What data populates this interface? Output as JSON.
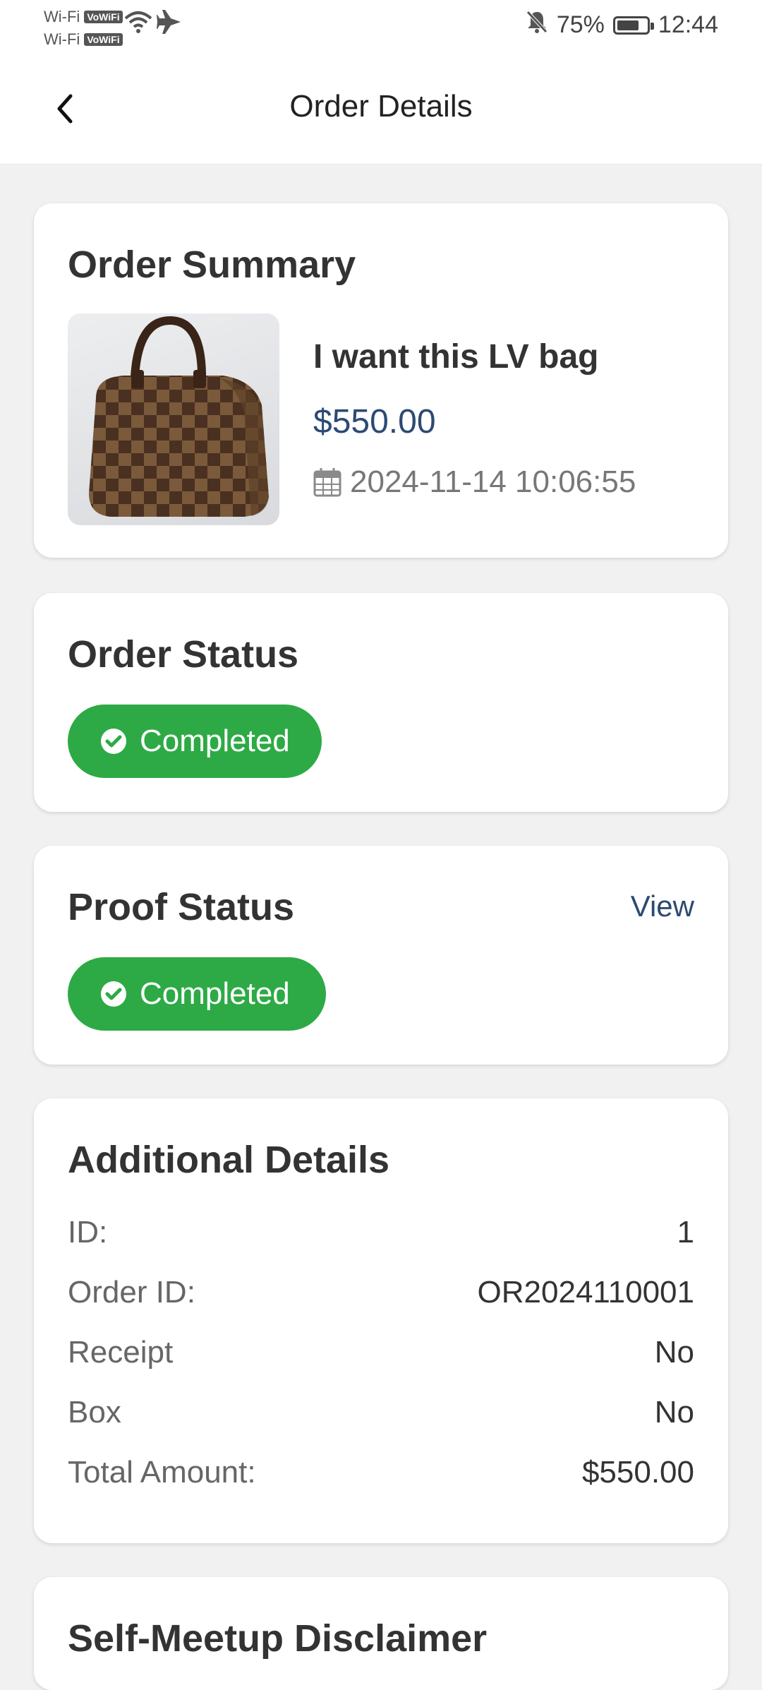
{
  "status_bar": {
    "net1": "Wi-Fi",
    "net2": "Wi-Fi",
    "vowifi": "VoWiFi",
    "battery": "75%",
    "time": "12:44"
  },
  "header": {
    "title": "Order Details"
  },
  "summary": {
    "title": "Order Summary",
    "product_name": "I want this LV bag",
    "price": "$550.00",
    "date": "2024-11-14 10:06:55"
  },
  "order_status": {
    "title": "Order Status",
    "badge": "Completed"
  },
  "proof_status": {
    "title": "Proof Status",
    "view": "View",
    "badge": "Completed"
  },
  "details": {
    "title": "Additional Details",
    "rows": [
      {
        "label": "ID:",
        "value": "1"
      },
      {
        "label": "Order ID:",
        "value": "OR2024110001"
      },
      {
        "label": "Receipt",
        "value": "No"
      },
      {
        "label": "Box",
        "value": "No"
      },
      {
        "label": "Total Amount:",
        "value": "$550.00"
      }
    ]
  },
  "disclaimer": {
    "title": "Self-Meetup Disclaimer"
  },
  "colors": {
    "accent": "#2c4a73",
    "success": "#2daa45",
    "background": "#f1f1f1"
  }
}
